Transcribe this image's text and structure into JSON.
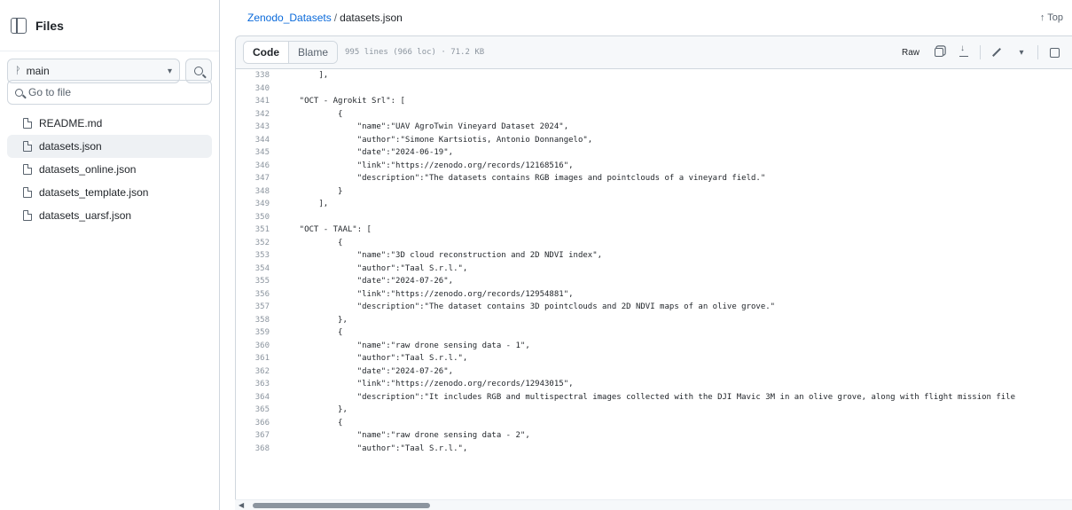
{
  "sidebar": {
    "title": "Files",
    "branch": "main",
    "goto_placeholder": "Go to file",
    "files": [
      {
        "name": "README.md",
        "active": false
      },
      {
        "name": "datasets.json",
        "active": true
      },
      {
        "name": "datasets_online.json",
        "active": false
      },
      {
        "name": "datasets_template.json",
        "active": false
      },
      {
        "name": "datasets_uarsf.json",
        "active": false
      }
    ]
  },
  "header": {
    "repo": "Zenodo_Datasets",
    "sep": "/",
    "file": "datasets.json",
    "top_link": "↑ Top"
  },
  "toolbar": {
    "code_tab": "Code",
    "blame_tab": "Blame",
    "file_info": "995 lines (966 loc) · 71.2 KB",
    "raw_label": "Raw"
  },
  "code_lines": [
    {
      "n": "338",
      "t": "        ],"
    },
    {
      "n": "340",
      "t": ""
    },
    {
      "n": "341",
      "t": "    \"OCT - Agrokit Srl\": ["
    },
    {
      "n": "342",
      "t": "            {"
    },
    {
      "n": "343",
      "t": "                \"name\":\"UAV AgroTwin Vineyard Dataset 2024\","
    },
    {
      "n": "344",
      "t": "                \"author\":\"Simone Kartsiotis, Antonio Donnangelo\","
    },
    {
      "n": "345",
      "t": "                \"date\":\"2024-06-19\","
    },
    {
      "n": "346",
      "t": "                \"link\":\"https://zenodo.org/records/12168516\","
    },
    {
      "n": "347",
      "t": "                \"description\":\"The datasets contains RGB images and pointclouds of a vineyard field.\""
    },
    {
      "n": "348",
      "t": "            }"
    },
    {
      "n": "349",
      "t": "        ],"
    },
    {
      "n": "350",
      "t": ""
    },
    {
      "n": "351",
      "t": "    \"OCT - TAAL\": ["
    },
    {
      "n": "352",
      "t": "            {"
    },
    {
      "n": "353",
      "t": "                \"name\":\"3D cloud reconstruction and 2D NDVI index\","
    },
    {
      "n": "354",
      "t": "                \"author\":\"Taal S.r.l.\","
    },
    {
      "n": "355",
      "t": "                \"date\":\"2024-07-26\","
    },
    {
      "n": "356",
      "t": "                \"link\":\"https://zenodo.org/records/12954881\","
    },
    {
      "n": "357",
      "t": "                \"description\":\"The dataset contains 3D pointclouds and 2D NDVI maps of an olive grove.\""
    },
    {
      "n": "358",
      "t": "            },"
    },
    {
      "n": "359",
      "t": "            {"
    },
    {
      "n": "360",
      "t": "                \"name\":\"raw drone sensing data - 1\","
    },
    {
      "n": "361",
      "t": "                \"author\":\"Taal S.r.l.\","
    },
    {
      "n": "362",
      "t": "                \"date\":\"2024-07-26\","
    },
    {
      "n": "363",
      "t": "                \"link\":\"https://zenodo.org/records/12943015\","
    },
    {
      "n": "364",
      "t": "                \"description\":\"It includes RGB and multispectral images collected with the DJI Mavic 3M in an olive grove, along with flight mission file"
    },
    {
      "n": "365",
      "t": "            },"
    },
    {
      "n": "366",
      "t": "            {"
    },
    {
      "n": "367",
      "t": "                \"name\":\"raw drone sensing data - 2\","
    },
    {
      "n": "368",
      "t": "                \"author\":\"Taal S.r.l.\","
    }
  ]
}
